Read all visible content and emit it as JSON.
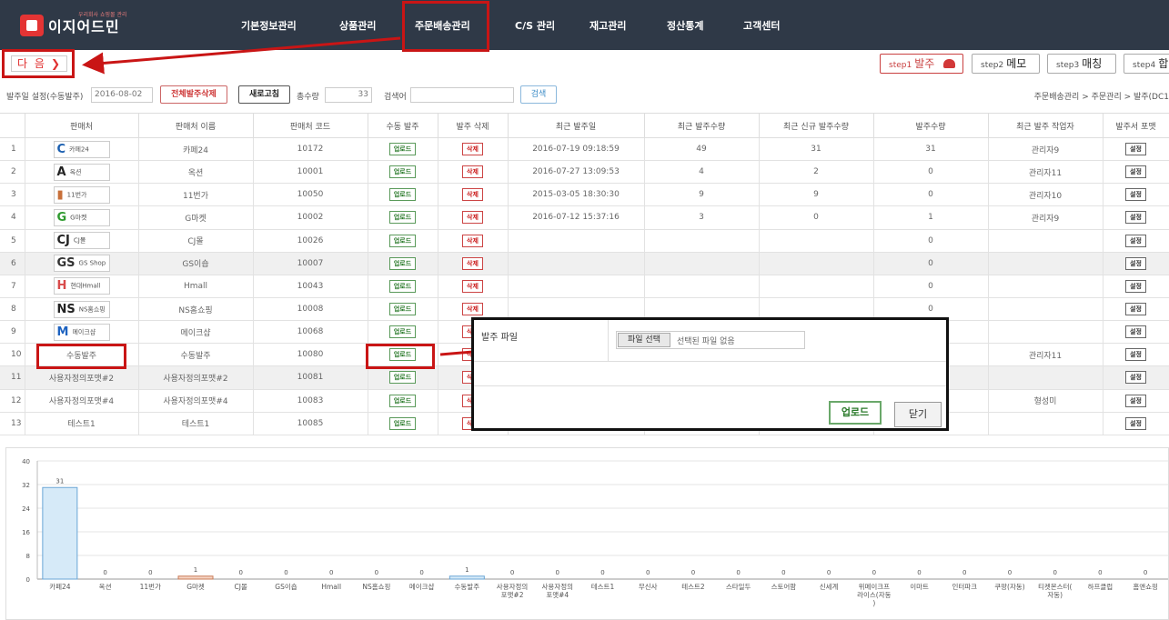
{
  "nav": {
    "logo_tagline": "우리회사 쇼핑몰 관리",
    "logo_name": "이지어드민",
    "items": [
      "기본정보관리",
      "상품관리",
      "주문배송관리",
      "C/S 관리",
      "재고관리",
      "정산통계",
      "고객센터"
    ]
  },
  "next_button": "다 음",
  "steps": [
    {
      "small": "step1",
      "big": "발주"
    },
    {
      "small": "step2",
      "big": "메모"
    },
    {
      "small": "step3",
      "big": "매칭"
    },
    {
      "small": "step4",
      "big": "합"
    }
  ],
  "filter": {
    "date_label": "발주일 설정(수동발주)",
    "date_value": "2016-08-02",
    "delete_all": "전체발주삭제",
    "refresh": "새로고침",
    "total_label": "총수량",
    "total_value": "33",
    "search_label": "검색어",
    "search_value": "",
    "search_button": "검색"
  },
  "breadcrumb": "주문배송관리 > 주문관리 > 발주(DC1",
  "table": {
    "columns": [
      "",
      "판매처",
      "판매처 이름",
      "판매처 코드",
      "수동 발주",
      "발주 삭제",
      "최근 발주일",
      "최근 발주수량",
      "최근 신규 발주수량",
      "발주수량",
      "최근 발주 작업자",
      "발주서 포맷"
    ],
    "upload_label": "업로드",
    "delete_label": "삭제",
    "setting_label": "설정",
    "rows": [
      {
        "no": "1",
        "icon": "C",
        "icon_color": "#1b5fb0",
        "vendor": "카페24",
        "name": "카페24",
        "code": "10172",
        "date": "2016-07-19 09:18:59",
        "recent": "49",
        "new": "31",
        "qty": "31",
        "worker": "관리자9"
      },
      {
        "no": "2",
        "icon": "A",
        "icon_color": "#222222",
        "vendor": "옥션",
        "name": "옥션",
        "code": "10001",
        "date": "2016-07-27 13:09:53",
        "recent": "4",
        "new": "2",
        "qty": "0",
        "worker": "관리자11"
      },
      {
        "no": "3",
        "icon": "▮",
        "icon_color": "#c8703a",
        "vendor": "11번가",
        "name": "11번가",
        "code": "10050",
        "date": "2015-03-05 18:30:30",
        "recent": "9",
        "new": "9",
        "qty": "0",
        "worker": "관리자10"
      },
      {
        "no": "4",
        "icon": "G",
        "icon_color": "#2f9a2f",
        "vendor": "G마켓",
        "name": "G마켓",
        "code": "10002",
        "date": "2016-07-12 15:37:16",
        "recent": "3",
        "new": "0",
        "qty": "1",
        "worker": "관리자9"
      },
      {
        "no": "5",
        "icon": "CJ",
        "icon_color": "#222222",
        "vendor": "CJ몰",
        "name": "CJ몰",
        "code": "10026",
        "date": "",
        "recent": "",
        "new": "",
        "qty": "0",
        "worker": ""
      },
      {
        "no": "6",
        "icon": "GS",
        "icon_color": "#333333",
        "vendor": "GS Shop",
        "name": "GS이숍",
        "code": "10007",
        "date": "",
        "recent": "",
        "new": "",
        "qty": "0",
        "worker": ""
      },
      {
        "no": "7",
        "icon": "H",
        "icon_color": "#d84a4a",
        "vendor": "현대Hmall",
        "name": "Hmall",
        "code": "10043",
        "date": "",
        "recent": "",
        "new": "",
        "qty": "0",
        "worker": ""
      },
      {
        "no": "8",
        "icon": "NS",
        "icon_color": "#222222",
        "vendor": "NS홈쇼핑",
        "name": "NS홈쇼핑",
        "code": "10008",
        "date": "",
        "recent": "",
        "new": "",
        "qty": "0",
        "worker": ""
      },
      {
        "no": "9",
        "icon": "M",
        "icon_color": "#1e63c0",
        "vendor": "메이크샵",
        "name": "메이크샵",
        "code": "10068",
        "date": "",
        "recent": "",
        "new": "",
        "qty": "",
        "worker": ""
      },
      {
        "no": "10",
        "icon": "",
        "icon_color": "",
        "vendor": "수동발주",
        "name": "수동발주",
        "code": "10080",
        "date": "",
        "recent": "",
        "new": "",
        "qty": "",
        "worker": "관리자11"
      },
      {
        "no": "11",
        "icon": "",
        "icon_color": "",
        "vendor": "사용자정의포맷#2",
        "name": "사용자정의포맷#2",
        "code": "10081",
        "date": "",
        "recent": "",
        "new": "",
        "qty": "",
        "worker": ""
      },
      {
        "no": "12",
        "icon": "",
        "icon_color": "",
        "vendor": "사용자정의포맷#4",
        "name": "사용자정의포맷#4",
        "code": "10083",
        "date": "",
        "recent": "",
        "new": "",
        "qty": "",
        "worker": "형성미"
      },
      {
        "no": "13",
        "icon": "",
        "icon_color": "",
        "vendor": "테스트1",
        "name": "테스트1",
        "code": "10085",
        "date": "",
        "recent": "",
        "new": "",
        "qty": "",
        "worker": ""
      }
    ]
  },
  "popup": {
    "title": "발주 파일",
    "file_button": "파일 선택",
    "file_status": "선택된 파일 없음",
    "upload": "업로드",
    "close": "닫기"
  },
  "chart_data": {
    "type": "bar",
    "title": "",
    "xlabel": "",
    "ylabel": "",
    "ylim": [
      0,
      40
    ],
    "yticks": [
      0,
      8,
      16,
      24,
      32,
      40
    ],
    "grid": true,
    "categories": [
      "카페24",
      "옥션",
      "11번가",
      "G마켓",
      "CJ몰",
      "GS이숍",
      "Hmall",
      "NS홈쇼핑",
      "메이크샵",
      "수동발주",
      "사용자정의포맷#2",
      "사용자정의포맷#4",
      "테스트1",
      "무신사",
      "테스트2",
      "스타일두",
      "스토어팜",
      "신세계",
      "위메이크프라이스(자동)",
      "이마트",
      "인터파크",
      "쿠팡(자동)",
      "티켓몬스터(자동)",
      "하프클럽",
      "홈앤쇼핑"
    ],
    "values": [
      31,
      0,
      0,
      1,
      0,
      0,
      0,
      0,
      0,
      1,
      0,
      0,
      0,
      0,
      0,
      0,
      0,
      0,
      0,
      0,
      0,
      0,
      0,
      0,
      0
    ],
    "label_lines": [
      [
        "카페24"
      ],
      [
        "옥션"
      ],
      [
        "11번가"
      ],
      [
        "G마켓"
      ],
      [
        "CJ몰"
      ],
      [
        "GS이숍"
      ],
      [
        "Hmall"
      ],
      [
        "NS홈쇼핑"
      ],
      [
        "메이크샵"
      ],
      [
        "수동발주"
      ],
      [
        "사용자정의",
        "포맷#2"
      ],
      [
        "사용자정의",
        "포맷#4"
      ],
      [
        "테스트1"
      ],
      [
        "무신사"
      ],
      [
        "테스트2"
      ],
      [
        "스타일두"
      ],
      [
        "스토어팜"
      ],
      [
        "신세계"
      ],
      [
        "위메이크프",
        "라이스(자동",
        ")"
      ],
      [
        "이마트"
      ],
      [
        "인터파크"
      ],
      [
        "쿠팡(자동)"
      ],
      [
        "티켓몬스터(",
        "자동)"
      ],
      [
        "하프클럽"
      ],
      [
        "홈앤쇼핑"
      ]
    ],
    "colors": {
      "default": "#d6eaf8",
      "default_stroke": "#6aa6d6",
      "highlight": "#f5d3c2",
      "highlight_stroke": "#c97b57"
    }
  }
}
